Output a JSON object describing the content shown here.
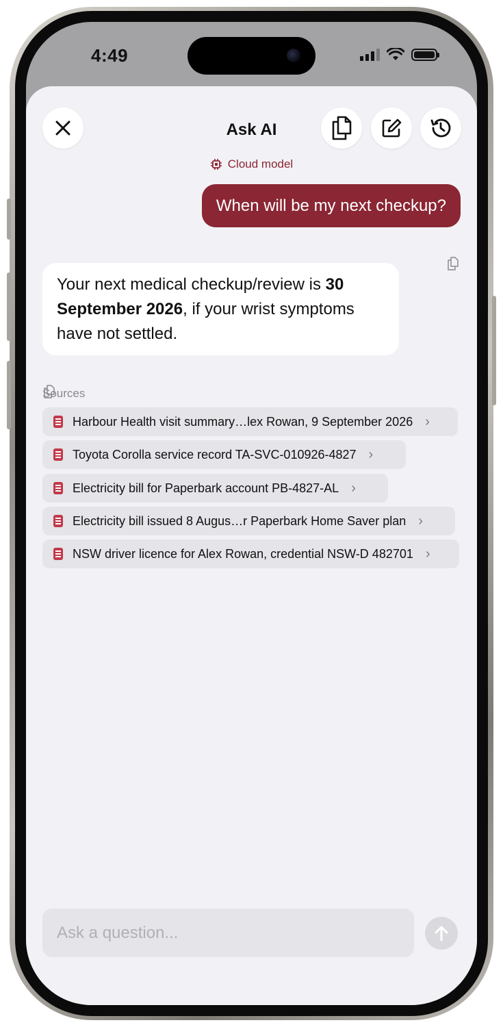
{
  "status_bar": {
    "time": "4:49"
  },
  "header": {
    "title": "Ask AI"
  },
  "model": {
    "label": "Cloud model"
  },
  "conversation": {
    "user_message": "When will be my next checkup?",
    "ai_response": {
      "prefix": "Your next medical checkup/review is ",
      "emphasis": "30 September 2026",
      "suffix": ", if your wrist symptoms have not settled."
    }
  },
  "sources": {
    "label": "Sources",
    "items": [
      {
        "label": "Harbour Health visit summary…lex Rowan, 9 September 2026"
      },
      {
        "label": "Toyota Corolla service record TA-SVC-010926-4827"
      },
      {
        "label": "Electricity bill for Paperbark account PB-4827-AL"
      },
      {
        "label": "Electricity bill issued 8 Augus…r Paperbark Home Saver plan"
      },
      {
        "label": "NSW driver licence for Alex Rowan, credential NSW-D 482701"
      }
    ]
  },
  "composer": {
    "placeholder": "Ask a question..."
  },
  "icons": {
    "close": "close-icon",
    "copy_all": "copy-document-icon",
    "new_chat": "compose-icon",
    "history": "history-icon",
    "chip": "chip-icon",
    "source": "pdf-document-icon",
    "send": "arrow-up-icon"
  },
  "colors": {
    "accent": "#8b2634",
    "sheet_background": "#f2f2f6",
    "source_chip": "#e4e4e9"
  }
}
